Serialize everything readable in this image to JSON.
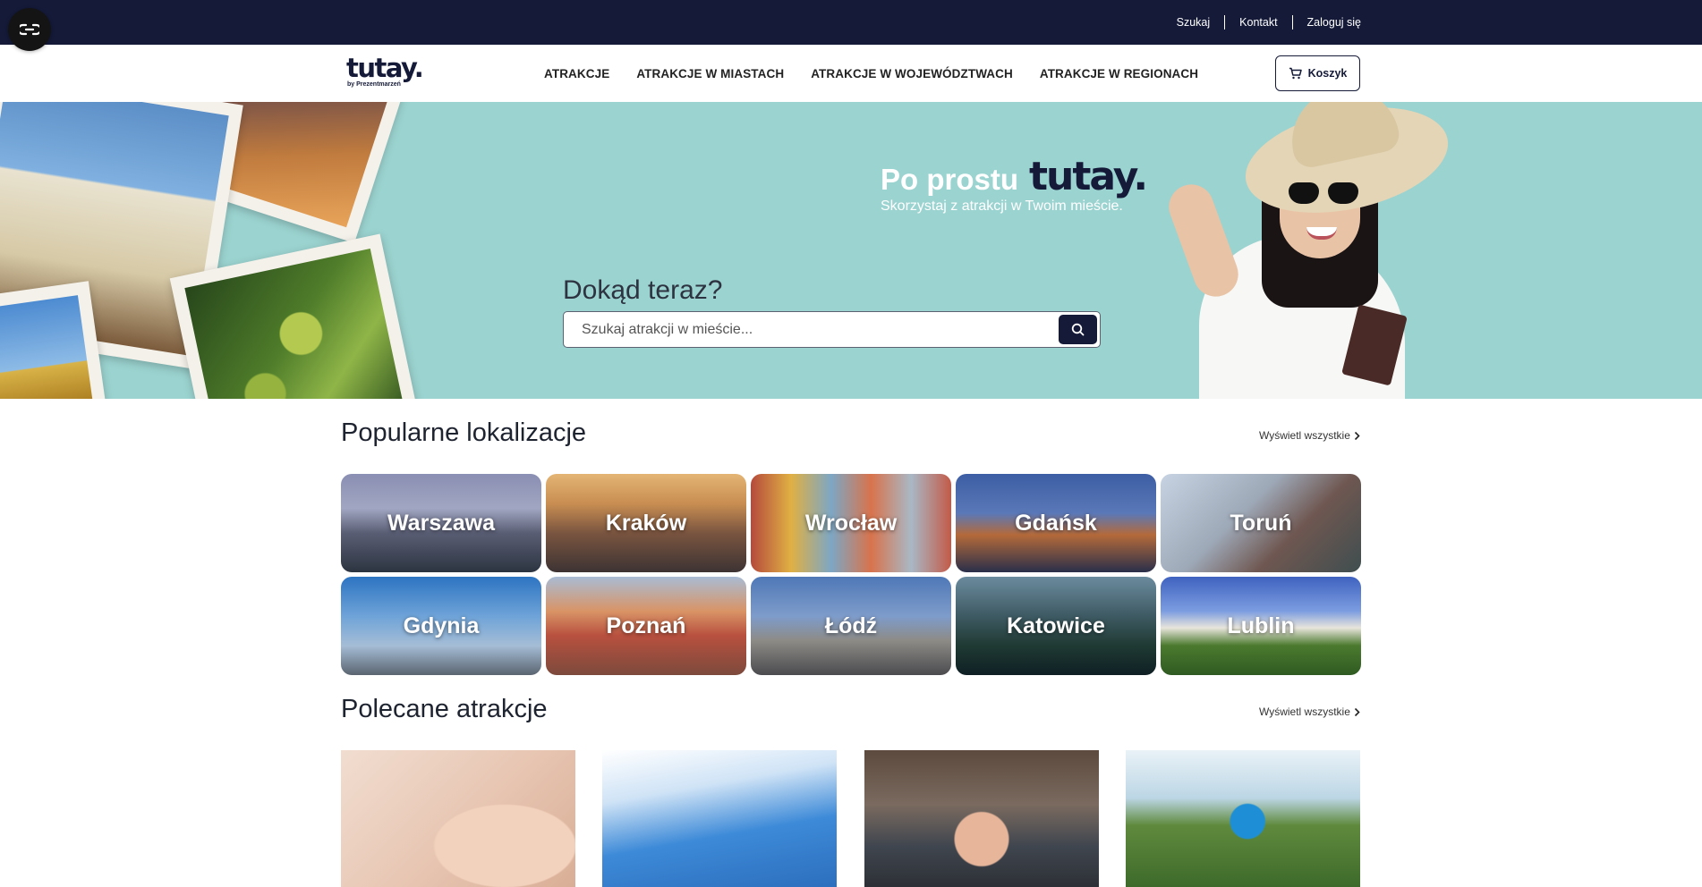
{
  "topbar": {
    "links": [
      "Szukaj",
      "Kontakt",
      "Zaloguj się"
    ]
  },
  "header": {
    "logo_text": "tutay.",
    "logo_subtext": "by Prezentmarzeń",
    "nav": [
      "ATRAKCJE",
      "ATRAKCJE W MIASTACH",
      "ATRAKCJE W WOJEWÓDZTWACH",
      "ATRAKCJE W REGIONACH"
    ],
    "cart_label": "Koszyk"
  },
  "hero": {
    "title_prefix": "Po prostu",
    "title_brand": "tutay.",
    "subtitle": "Skorzystaj z atrakcji w Twoim mieście.",
    "question": "Dokąd teraz?",
    "search_placeholder": "Szukaj atrakcji w mieście..."
  },
  "popular": {
    "title": "Popularne lokalizacje",
    "view_all": "Wyświetl wszystkie",
    "cities": [
      "Warszawa",
      "Kraków",
      "Wrocław",
      "Gdańsk",
      "Toruń",
      "Gdynia",
      "Poznań",
      "Łódź",
      "Katowice",
      "Lublin"
    ]
  },
  "recommended": {
    "title": "Polecane atrakcje",
    "view_all": "Wyświetl wszystkie"
  },
  "colors": {
    "navy": "#141a38",
    "hero_bg": "#9bd3d0",
    "white": "#ffffff"
  },
  "icons": [
    "accessibility-icon",
    "cart-icon",
    "search-icon",
    "chevron-right-icon"
  ]
}
